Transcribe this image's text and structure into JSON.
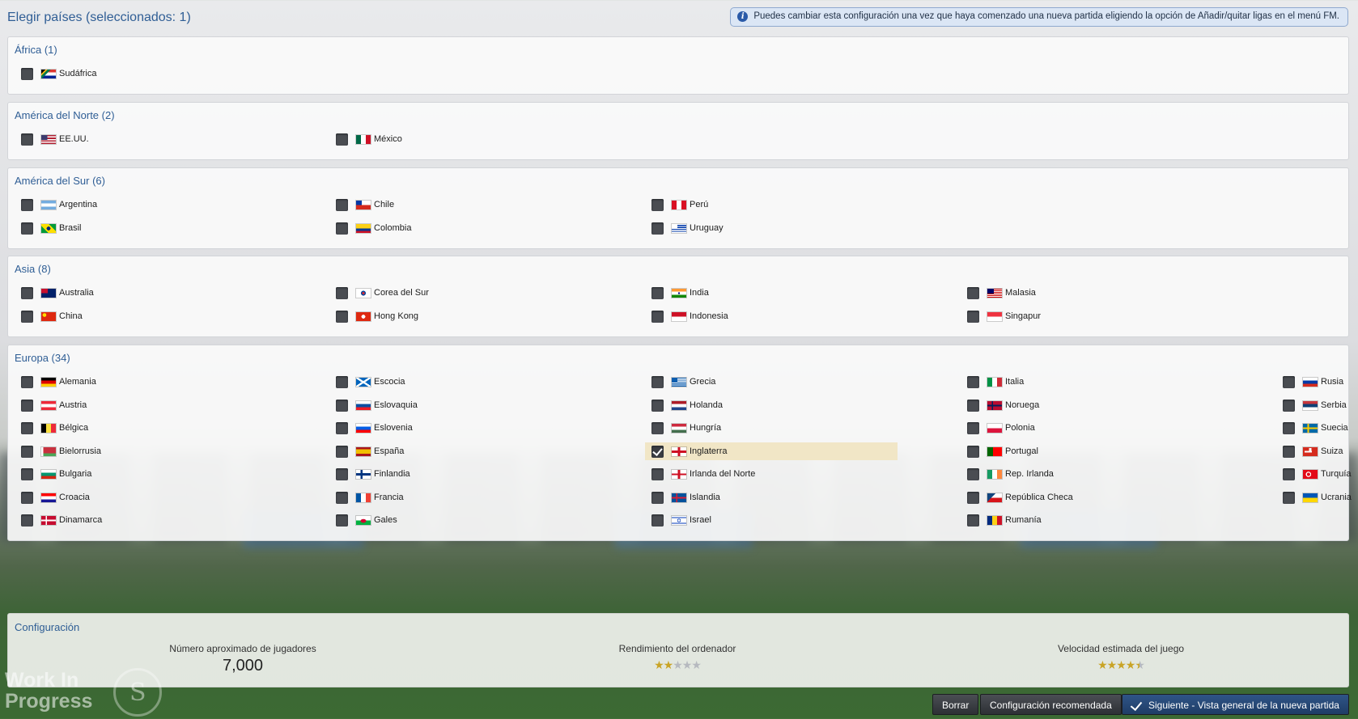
{
  "header": {
    "title": "Elegir países (seleccionados: 1)",
    "info": "Puedes cambiar esta configuración una vez que haya comenzado una nueva partida eligiendo la opción de Añadir/quitar ligas en el menú FM."
  },
  "regions": [
    {
      "title": "África (1)",
      "countries": [
        {
          "name": "Sudáfrica",
          "flag": "za",
          "checked": false
        }
      ]
    },
    {
      "title": "América del Norte (2)",
      "countries": [
        {
          "name": "EE.UU.",
          "flag": "us",
          "checked": false
        },
        {
          "name": "México",
          "flag": "mx",
          "checked": false
        }
      ]
    },
    {
      "title": "América del Sur (6)",
      "countries": [
        {
          "name": "Argentina",
          "flag": "ar",
          "checked": false
        },
        {
          "name": "Brasil",
          "flag": "br",
          "checked": false
        },
        {
          "name": "Chile",
          "flag": "cl",
          "checked": false
        },
        {
          "name": "Colombia",
          "flag": "co",
          "checked": false
        },
        {
          "name": "Perú",
          "flag": "pe",
          "checked": false
        },
        {
          "name": "Uruguay",
          "flag": "uy",
          "checked": false
        }
      ]
    },
    {
      "title": "Asia (8)",
      "countries": [
        {
          "name": "Australia",
          "flag": "au",
          "checked": false
        },
        {
          "name": "China",
          "flag": "cn",
          "checked": false
        },
        {
          "name": "Corea del Sur",
          "flag": "kr",
          "checked": false
        },
        {
          "name": "Hong Kong",
          "flag": "hk",
          "checked": false
        },
        {
          "name": "India",
          "flag": "in",
          "checked": false
        },
        {
          "name": "Indonesia",
          "flag": "id",
          "checked": false
        },
        {
          "name": "Malasia",
          "flag": "my",
          "checked": false
        },
        {
          "name": "Singapur",
          "flag": "sg",
          "checked": false
        }
      ]
    },
    {
      "title": "Europa (34)",
      "countries": [
        {
          "name": "Alemania",
          "flag": "de",
          "checked": false
        },
        {
          "name": "Austria",
          "flag": "at",
          "checked": false
        },
        {
          "name": "Bélgica",
          "flag": "be",
          "checked": false
        },
        {
          "name": "Bielorrusia",
          "flag": "by",
          "checked": false
        },
        {
          "name": "Bulgaria",
          "flag": "bg",
          "checked": false
        },
        {
          "name": "Croacia",
          "flag": "hr",
          "checked": false
        },
        {
          "name": "Dinamarca",
          "flag": "dk",
          "checked": false
        },
        {
          "name": "Escocia",
          "flag": "sct",
          "checked": false
        },
        {
          "name": "Eslovaquia",
          "flag": "sk",
          "checked": false
        },
        {
          "name": "Eslovenia",
          "flag": "si",
          "checked": false
        },
        {
          "name": "España",
          "flag": "es",
          "checked": false
        },
        {
          "name": "Finlandia",
          "flag": "fi",
          "checked": false
        },
        {
          "name": "Francia",
          "flag": "fr",
          "checked": false
        },
        {
          "name": "Gales",
          "flag": "wls",
          "checked": false
        },
        {
          "name": "Grecia",
          "flag": "gr",
          "checked": false
        },
        {
          "name": "Holanda",
          "flag": "nl",
          "checked": false
        },
        {
          "name": "Hungría",
          "flag": "hu",
          "checked": false
        },
        {
          "name": "Inglaterra",
          "flag": "eng",
          "checked": true
        },
        {
          "name": "Irlanda del Norte",
          "flag": "nir",
          "checked": false
        },
        {
          "name": "Islandia",
          "flag": "is",
          "checked": false
        },
        {
          "name": "Israel",
          "flag": "il",
          "checked": false
        },
        {
          "name": "Italia",
          "flag": "it",
          "checked": false
        },
        {
          "name": "Noruega",
          "flag": "no",
          "checked": false
        },
        {
          "name": "Polonia",
          "flag": "pl",
          "checked": false
        },
        {
          "name": "Portugal",
          "flag": "pt",
          "checked": false
        },
        {
          "name": "Rep. Irlanda",
          "flag": "ie",
          "checked": false
        },
        {
          "name": "República Checa",
          "flag": "cz",
          "checked": false
        },
        {
          "name": "Rumanía",
          "flag": "ro",
          "checked": false
        },
        {
          "name": "Rusia",
          "flag": "ru",
          "checked": false
        },
        {
          "name": "Serbia",
          "flag": "rs",
          "checked": false
        },
        {
          "name": "Suecia",
          "flag": "se",
          "checked": false
        },
        {
          "name": "Suiza",
          "flag": "ch",
          "checked": false
        },
        {
          "name": "Turquía",
          "flag": "tr",
          "checked": false
        },
        {
          "name": "Ucrania",
          "flag": "ua",
          "checked": false
        }
      ]
    }
  ],
  "config": {
    "title": "Configuración",
    "players_label": "Número aproximado de jugadores",
    "players_value": "7,000",
    "performance_label": "Rendimiento del ordenador",
    "performance_rating": 2,
    "speed_label": "Velocidad estimada del juego",
    "speed_rating": 4.5
  },
  "watermark": {
    "line1": "Work In",
    "line2": "Progress"
  },
  "buttons": {
    "clear": "Borrar",
    "recommended": "Configuración recomendada",
    "next": "Siguiente - Vista general de la nueva partida"
  }
}
